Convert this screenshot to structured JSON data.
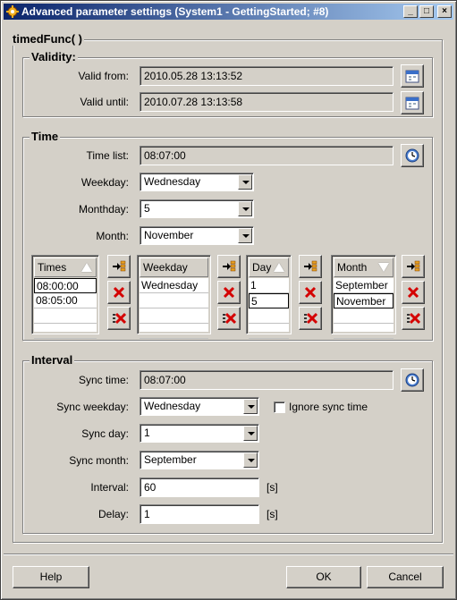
{
  "window": {
    "title": "Advanced parameter settings (System1 - GettingStarted; #8)",
    "minimize": "_",
    "maximize": "□",
    "close": "×"
  },
  "func_group": {
    "title": "timedFunc( )"
  },
  "validity": {
    "title": "Validity:",
    "from_label": "Valid from:",
    "from_value": "2010.05.28 13:13:52",
    "until_label": "Valid until:",
    "until_value": "2010.07.28 13:13:58",
    "icon": "calendar-icon"
  },
  "time": {
    "title": "Time",
    "time_list_label": "Time list:",
    "time_list_value": "08:07:00",
    "weekday_label": "Weekday:",
    "weekday_value": "Wednesday",
    "monthday_label": "Monthday:",
    "monthday_value": "5",
    "month_label": "Month:",
    "month_value": "November",
    "lists": {
      "times": {
        "header": "Times",
        "rows": [
          "08:00:00",
          "08:05:00",
          "",
          ""
        ]
      },
      "weekday": {
        "header": "Weekday",
        "rows": [
          "Wednesday",
          "",
          "",
          ""
        ]
      },
      "day": {
        "header": "Day",
        "rows": [
          "1",
          "5",
          "",
          ""
        ]
      },
      "month": {
        "header": "Month",
        "rows": [
          "September",
          "November",
          "",
          ""
        ]
      }
    }
  },
  "interval": {
    "title": "Interval",
    "sync_time_label": "Sync time:",
    "sync_time_value": "08:07:00",
    "sync_weekday_label": "Sync weekday:",
    "sync_weekday_value": "Wednesday",
    "ignore_sync_label": "Ignore sync time",
    "ignore_sync_checked": false,
    "sync_day_label": "Sync day:",
    "sync_day_value": "1",
    "sync_month_label": "Sync month:",
    "sync_month_value": "September",
    "interval_label": "Interval:",
    "interval_value": "60",
    "interval_unit": "[s]",
    "delay_label": "Delay:",
    "delay_value": "1",
    "delay_unit": "[s]"
  },
  "buttons": {
    "help": "Help",
    "ok": "OK",
    "cancel": "Cancel"
  },
  "colors": {
    "titlebar_start": "#0a246a",
    "titlebar_end": "#a6caf0",
    "face": "#d4d0c8",
    "delete_red": "#d40000"
  }
}
